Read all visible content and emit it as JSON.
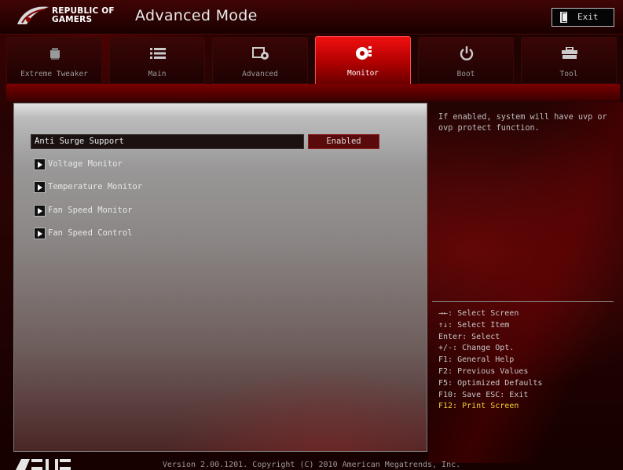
{
  "header": {
    "brand_line1": "REPUBLIC OF",
    "brand_line2": "GAMERS",
    "title": "Advanced Mode",
    "exit_label": "Exit"
  },
  "tabs": [
    {
      "label": "Extreme Tweaker",
      "icon": "cpu-chip-icon",
      "active": false
    },
    {
      "label": "Main",
      "icon": "list-icon",
      "active": false
    },
    {
      "label": "Advanced",
      "icon": "advanced-settings-icon",
      "active": false
    },
    {
      "label": "Monitor",
      "icon": "monitor-gauge-icon",
      "active": true
    },
    {
      "label": "Boot",
      "icon": "power-icon",
      "active": false
    },
    {
      "label": "Tool",
      "icon": "toolbox-icon",
      "active": false
    }
  ],
  "main": {
    "setting": {
      "label": "Anti Surge Support",
      "value": "Enabled"
    },
    "submenus": [
      "Voltage Monitor",
      "Temperature Monitor",
      "Fan Speed Monitor",
      "Fan Speed Control"
    ]
  },
  "help": {
    "text": "If enabled, system will have uvp or ovp protect function."
  },
  "legend": [
    "→←: Select Screen",
    "↑↓: Select Item",
    "Enter: Select",
    "+/-: Change Opt.",
    "F1: General Help",
    "F2: Previous Values",
    "F5: Optimized Defaults",
    "F10: Save  ESC: Exit",
    "F12: Print Screen"
  ],
  "footer": {
    "version": "Version 2.00.1201. Copyright (C) 2010 American Megatrends, Inc.",
    "logo_text": "ASUS"
  },
  "colors": {
    "accent": "#d00000",
    "highlight": "#f2d238"
  }
}
